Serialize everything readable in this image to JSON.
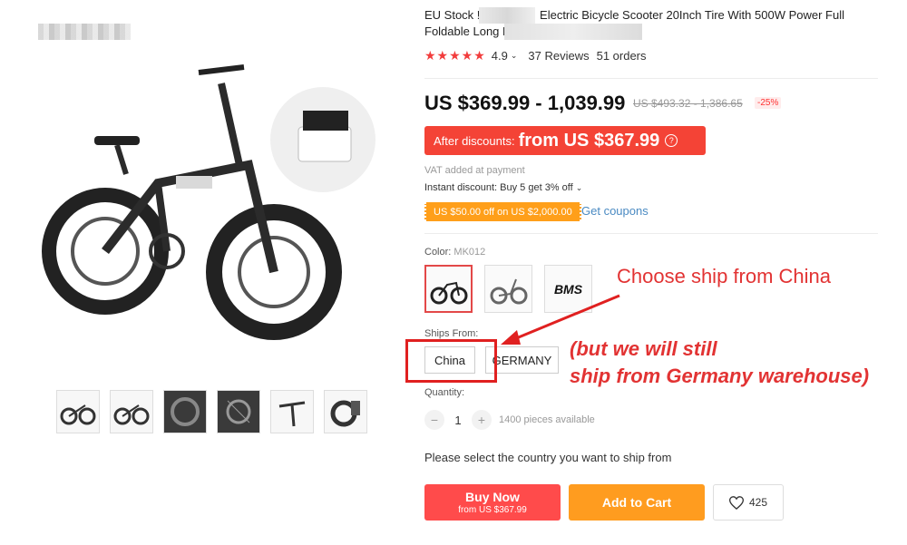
{
  "product": {
    "title_part1": "EU Stock ! ",
    "title_part2": "Electric Bicycle Scooter 20Inch Tire With 500W Power Full Foldable Long Range",
    "rating": "4.9",
    "reviews": "37 Reviews",
    "orders": "51 orders"
  },
  "price": {
    "range": "US $369.99 - 1,039.99",
    "original": "US $493.32 - 1,386.65",
    "discount_pct": "-25%",
    "after_discount_label": "After discounts:",
    "after_discount_value": "from US $367.99"
  },
  "info": {
    "vat": "VAT added at payment",
    "instant": "Instant discount: Buy 5 get 3% off",
    "coupon_badge": "US $50.00 off on US $2,000.00",
    "get_coupons": "Get coupons"
  },
  "color": {
    "label": "Color:",
    "value": "MK012",
    "variant_badge": "BMS"
  },
  "ships": {
    "label": "Ships From:",
    "options": [
      "China",
      "GERMANY"
    ]
  },
  "quantity": {
    "label": "Quantity:",
    "value": "1",
    "available": "1400 pieces available",
    "minus": "−",
    "plus": "+"
  },
  "note": "Please select the country you want to ship from",
  "actions": {
    "buy_now": "Buy Now",
    "buy_now_sub": "from US $367.99",
    "add_to_cart": "Add to Cart",
    "wish_count": "425"
  },
  "annotations": {
    "text1": "Choose ship from China",
    "text2_line1": "(but we will still",
    "text2_line2": "ship from Germany warehouse)"
  },
  "colors": {
    "accent_red": "#f44336",
    "orange": "#ff9c1f",
    "link_blue": "#4a8ac2"
  }
}
